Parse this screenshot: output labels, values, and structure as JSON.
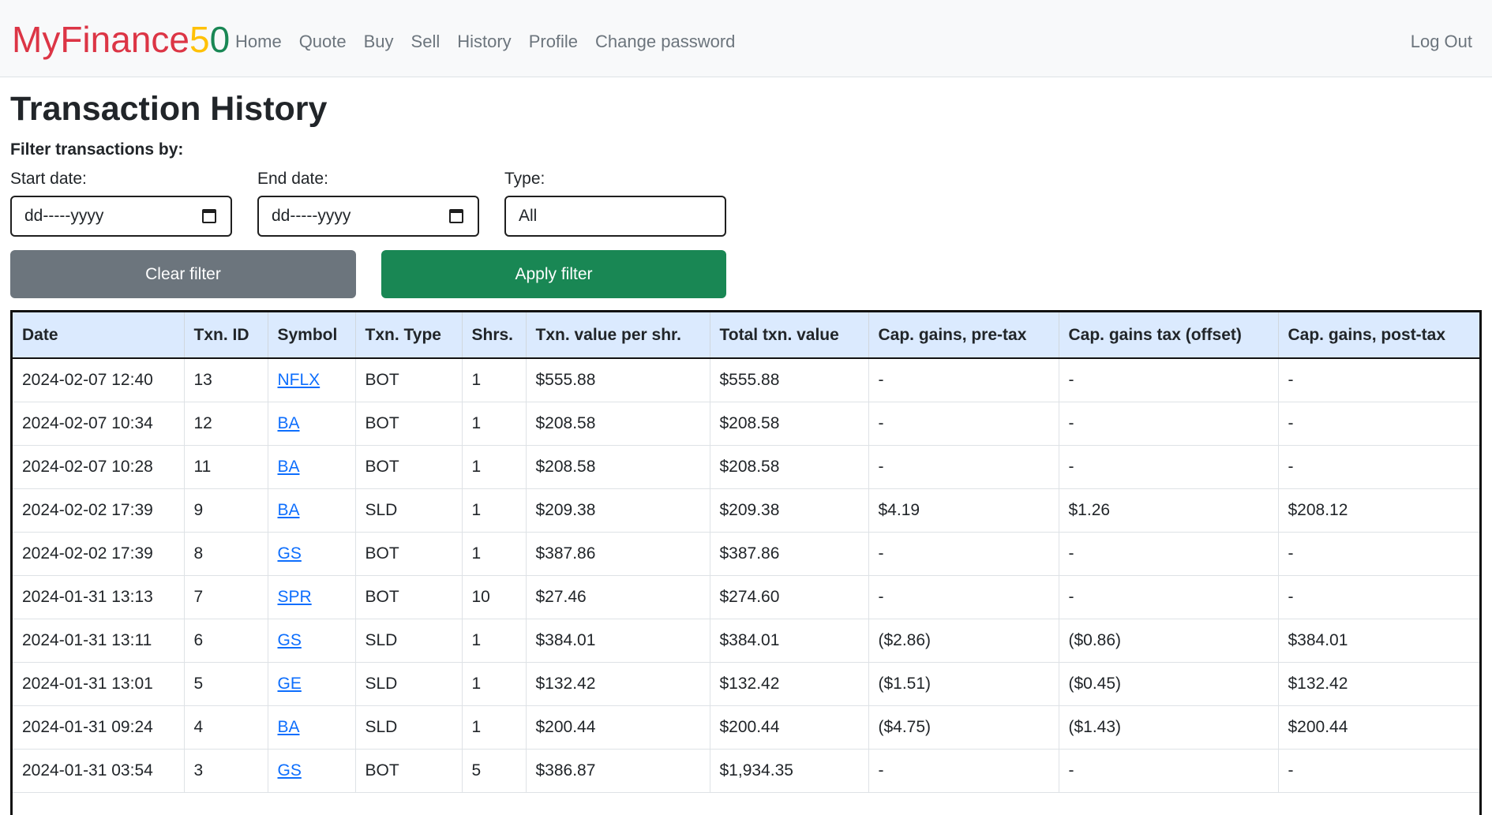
{
  "brand": {
    "parts": [
      {
        "text": "My",
        "color": "#dc3545"
      },
      {
        "text": "Finance",
        "color": "#dc3545"
      },
      {
        "text": "5",
        "color": "#ffc107"
      },
      {
        "text": "0",
        "color": "#198754"
      }
    ]
  },
  "nav": {
    "items": [
      "Home",
      "Quote",
      "Buy",
      "Sell",
      "History",
      "Profile",
      "Change password"
    ],
    "logout": "Log Out"
  },
  "page": {
    "title": "Transaction History",
    "filter_heading": "Filter transactions by:"
  },
  "filters": {
    "start_label": "Start date:",
    "start_value": "dd-----yyyy",
    "end_label": "End date:",
    "end_value": "dd-----yyyy",
    "type_label": "Type:",
    "type_value": "All",
    "clear_label": "Clear filter",
    "apply_label": "Apply filter"
  },
  "table": {
    "headers": [
      "Date",
      "Txn. ID",
      "Symbol",
      "Txn. Type",
      "Shrs.",
      "Txn. value per shr.",
      "Total txn. value",
      "Cap. gains, pre-tax",
      "Cap. gains tax (offset)",
      "Cap. gains, post-tax"
    ],
    "rows": [
      [
        "2024-02-07 12:40",
        "13",
        "NFLX",
        "BOT",
        "1",
        "$555.88",
        "$555.88",
        "-",
        "-",
        "-"
      ],
      [
        "2024-02-07 10:34",
        "12",
        "BA",
        "BOT",
        "1",
        "$208.58",
        "$208.58",
        "-",
        "-",
        "-"
      ],
      [
        "2024-02-07 10:28",
        "11",
        "BA",
        "BOT",
        "1",
        "$208.58",
        "$208.58",
        "-",
        "-",
        "-"
      ],
      [
        "2024-02-02 17:39",
        "9",
        "BA",
        "SLD",
        "1",
        "$209.38",
        "$209.38",
        "$4.19",
        "$1.26",
        "$208.12"
      ],
      [
        "2024-02-02 17:39",
        "8",
        "GS",
        "BOT",
        "1",
        "$387.86",
        "$387.86",
        "-",
        "-",
        "-"
      ],
      [
        "2024-01-31 13:13",
        "7",
        "SPR",
        "BOT",
        "10",
        "$27.46",
        "$274.60",
        "-",
        "-",
        "-"
      ],
      [
        "2024-01-31 13:11",
        "6",
        "GS",
        "SLD",
        "1",
        "$384.01",
        "$384.01",
        "($2.86)",
        "($0.86)",
        "$384.01"
      ],
      [
        "2024-01-31 13:01",
        "5",
        "GE",
        "SLD",
        "1",
        "$132.42",
        "$132.42",
        "($1.51)",
        "($0.45)",
        "$132.42"
      ],
      [
        "2024-01-31 09:24",
        "4",
        "BA",
        "SLD",
        "1",
        "$200.44",
        "$200.44",
        "($4.75)",
        "($1.43)",
        "$200.44"
      ],
      [
        "2024-01-31 03:54",
        "3",
        "GS",
        "BOT",
        "5",
        "$386.87",
        "$1,934.35",
        "-",
        "-",
        "-"
      ]
    ]
  }
}
